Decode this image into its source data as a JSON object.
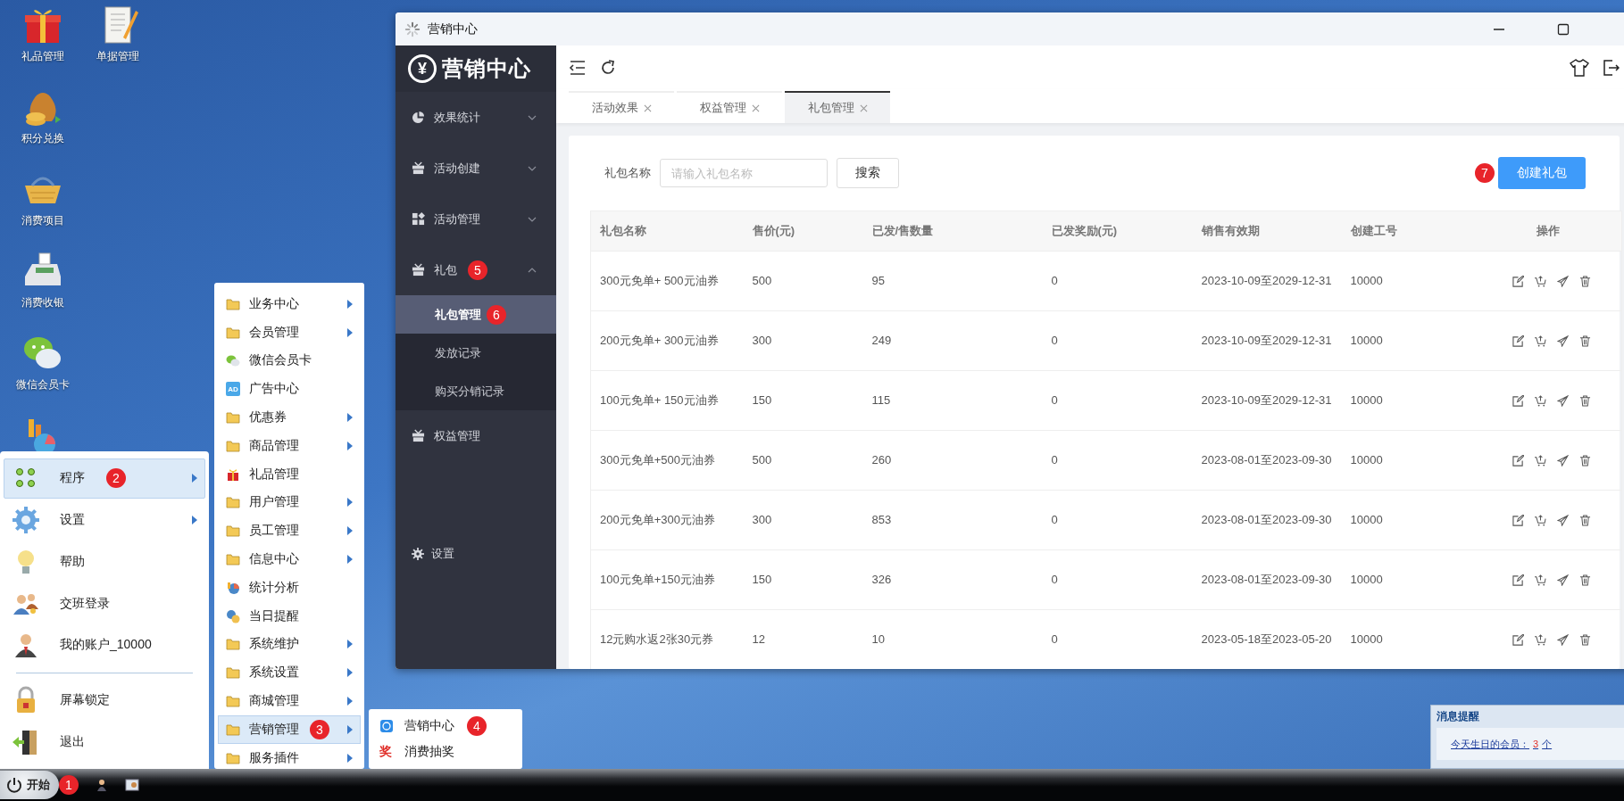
{
  "desktop_icons": [
    {
      "kind": "gift",
      "label": "礼品管理"
    },
    {
      "kind": "notebook",
      "label": "单据管理"
    },
    {
      "kind": "moneybag",
      "label": "积分兑换"
    },
    {
      "kind": "basket",
      "label": "消费项目"
    },
    {
      "kind": "register",
      "label": "消费收银"
    },
    {
      "kind": "wechat",
      "label": "微信会员卡"
    },
    {
      "kind": "chart"
    }
  ],
  "start_menu": {
    "items": [
      {
        "kind": "programs",
        "label": "程序",
        "selected": true,
        "has_submenu": true,
        "callout": "2"
      },
      {
        "kind": "settings",
        "label": "设置",
        "selected": false,
        "has_submenu": true
      },
      {
        "kind": "help",
        "label": "帮助",
        "selected": false,
        "has_submenu": false
      },
      {
        "kind": "shift",
        "label": "交班登录",
        "selected": false,
        "has_submenu": false
      },
      {
        "kind": "account",
        "label": "我的账户_10000",
        "selected": false,
        "has_submenu": false
      },
      {
        "kind": "lock",
        "label": "屏幕锁定",
        "selected": false,
        "has_submenu": false,
        "divider_before": true
      },
      {
        "kind": "exit",
        "label": "退出",
        "selected": false,
        "has_submenu": false
      }
    ]
  },
  "programs_menu": {
    "items": [
      {
        "kind": "folder",
        "label": "业务中心",
        "selected": false,
        "has_submenu": true
      },
      {
        "kind": "folder",
        "label": "会员管理",
        "selected": false,
        "has_submenu": true
      },
      {
        "kind": "wechat",
        "label": "微信会员卡",
        "selected": false,
        "has_submenu": false
      },
      {
        "kind": "ad",
        "icon_text": "AD",
        "label": "广告中心",
        "selected": false,
        "has_submenu": false
      },
      {
        "kind": "folder",
        "label": "优惠券",
        "selected": false,
        "has_submenu": true
      },
      {
        "kind": "folder",
        "label": "商品管理",
        "selected": false,
        "has_submenu": true
      },
      {
        "kind": "gift",
        "label": "礼品管理",
        "selected": false,
        "has_submenu": false
      },
      {
        "kind": "folder",
        "label": "用户管理",
        "selected": false,
        "has_submenu": true
      },
      {
        "kind": "folder",
        "label": "员工管理",
        "selected": false,
        "has_submenu": true
      },
      {
        "kind": "folder",
        "label": "信息中心",
        "selected": false,
        "has_submenu": true
      },
      {
        "kind": "stats",
        "label": "统计分析",
        "selected": false,
        "has_submenu": false
      },
      {
        "kind": "reminder",
        "label": "当日提醒",
        "selected": false,
        "has_submenu": false
      },
      {
        "kind": "folder",
        "label": "系统维护",
        "selected": false,
        "has_submenu": true
      },
      {
        "kind": "folder",
        "label": "系统设置",
        "selected": false,
        "has_submenu": true
      },
      {
        "kind": "folder",
        "label": "商城管理",
        "selected": false,
        "has_submenu": true
      },
      {
        "kind": "folder",
        "label": "营销管理",
        "selected": true,
        "has_submenu": true,
        "callout": "3"
      },
      {
        "kind": "folder",
        "label": "服务插件",
        "selected": false,
        "has_submenu": true
      }
    ]
  },
  "marketing_menu": {
    "items": [
      {
        "kind": "center",
        "label": "营销中心",
        "callout": "4"
      },
      {
        "kind": "lottery",
        "icon_text": "奖",
        "label": "消费抽奖"
      }
    ]
  },
  "taskbar": {
    "start_label": "开始",
    "callout": "1"
  },
  "window": {
    "title": "营销中心",
    "logo": {
      "symbol": "¥",
      "text": "营销中心"
    },
    "sidebar": {
      "items": [
        {
          "kind": "stats",
          "label": "效果统计",
          "expanded": false
        },
        {
          "kind": "create",
          "label": "活动创建",
          "expanded": false
        },
        {
          "kind": "manage",
          "label": "活动管理",
          "expanded": false
        },
        {
          "kind": "package",
          "label": "礼包",
          "expanded": true,
          "callout": "5",
          "children": [
            {
              "label": "礼包管理",
              "selected": true,
              "callout": "6"
            },
            {
              "label": "发放记录",
              "selected": false
            },
            {
              "label": "购买分销记录",
              "selected": false
            }
          ]
        },
        {
          "kind": "rights",
          "label": "权益管理"
        }
      ],
      "footer": "设置"
    },
    "tabs": [
      {
        "label": "活动效果",
        "selected": false
      },
      {
        "label": "权益管理",
        "selected": false
      },
      {
        "label": "礼包管理",
        "selected": true
      }
    ],
    "search": {
      "label": "礼包名称",
      "placeholder": "请输入礼包名称",
      "button": "搜索"
    },
    "create_button": {
      "label": "创建礼包",
      "callout": "7"
    },
    "table": {
      "columns": [
        "礼包名称",
        "售价(元)",
        "已发/售数量",
        "已发奖励(元)",
        "销售有效期",
        "创建工号",
        "操作"
      ],
      "rows": [
        [
          "300元免单+ 500元油券",
          "500",
          "95",
          "0",
          "2023-10-09至2029-12-31",
          "10000"
        ],
        [
          "200元免单+ 300元油券",
          "300",
          "249",
          "0",
          "2023-10-09至2029-12-31",
          "10000"
        ],
        [
          "100元免单+ 150元油券",
          "150",
          "115",
          "0",
          "2023-10-09至2029-12-31",
          "10000"
        ],
        [
          "300元免单+500元油券",
          "500",
          "260",
          "0",
          "2023-08-01至2023-09-30",
          "10000"
        ],
        [
          "200元免单+300元油券",
          "300",
          "853",
          "0",
          "2023-08-01至2023-09-30",
          "10000"
        ],
        [
          "100元免单+150元油券",
          "150",
          "326",
          "0",
          "2023-08-01至2023-09-30",
          "10000"
        ],
        [
          "12元购水返2张30元券",
          "12",
          "10",
          "0",
          "2023-05-18至2023-05-20",
          "10000"
        ]
      ]
    }
  },
  "notice": {
    "title": "消息提醒",
    "text": "今天生日的会员：",
    "count": "3",
    "unit": "个"
  }
}
